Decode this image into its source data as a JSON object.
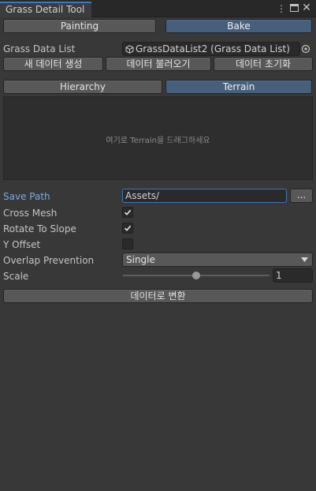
{
  "window": {
    "tab_title": "Grass Detail Tool"
  },
  "mode_tabs": [
    {
      "label": "Painting",
      "selected": false
    },
    {
      "label": "Bake",
      "selected": true
    }
  ],
  "grass_data_list": {
    "label": "Grass Data List",
    "value": "GrassDataList2 (Grass Data List)"
  },
  "data_buttons": {
    "new": "새 데이터 생성",
    "load": "데이터 불러오기",
    "reset": "데이터 초기화"
  },
  "view_tabs": [
    {
      "label": "Hierarchy",
      "selected": false
    },
    {
      "label": "Terrain",
      "selected": true
    }
  ],
  "drop_area": {
    "text": "여기로 Terrain을 드래그하세요"
  },
  "settings": {
    "save_path": {
      "label": "Save Path",
      "value": "Assets/",
      "browse_label": "..."
    },
    "cross_mesh": {
      "label": "Cross Mesh",
      "checked": true
    },
    "rotate_to_slope": {
      "label": "Rotate To Slope",
      "checked": true
    },
    "y_offset": {
      "label": "Y Offset",
      "checked": false
    },
    "overlap_prevention": {
      "label": "Overlap Prevention",
      "value": "Single"
    },
    "scale": {
      "label": "Scale",
      "value": "1",
      "slider_fraction": 0.5
    }
  },
  "convert_button": "데이터로 변환",
  "colors": {
    "accent": "#3a79bb",
    "selected_button": "#46607c",
    "label_highlight": "#7ba9e3",
    "panel": "#383838"
  }
}
